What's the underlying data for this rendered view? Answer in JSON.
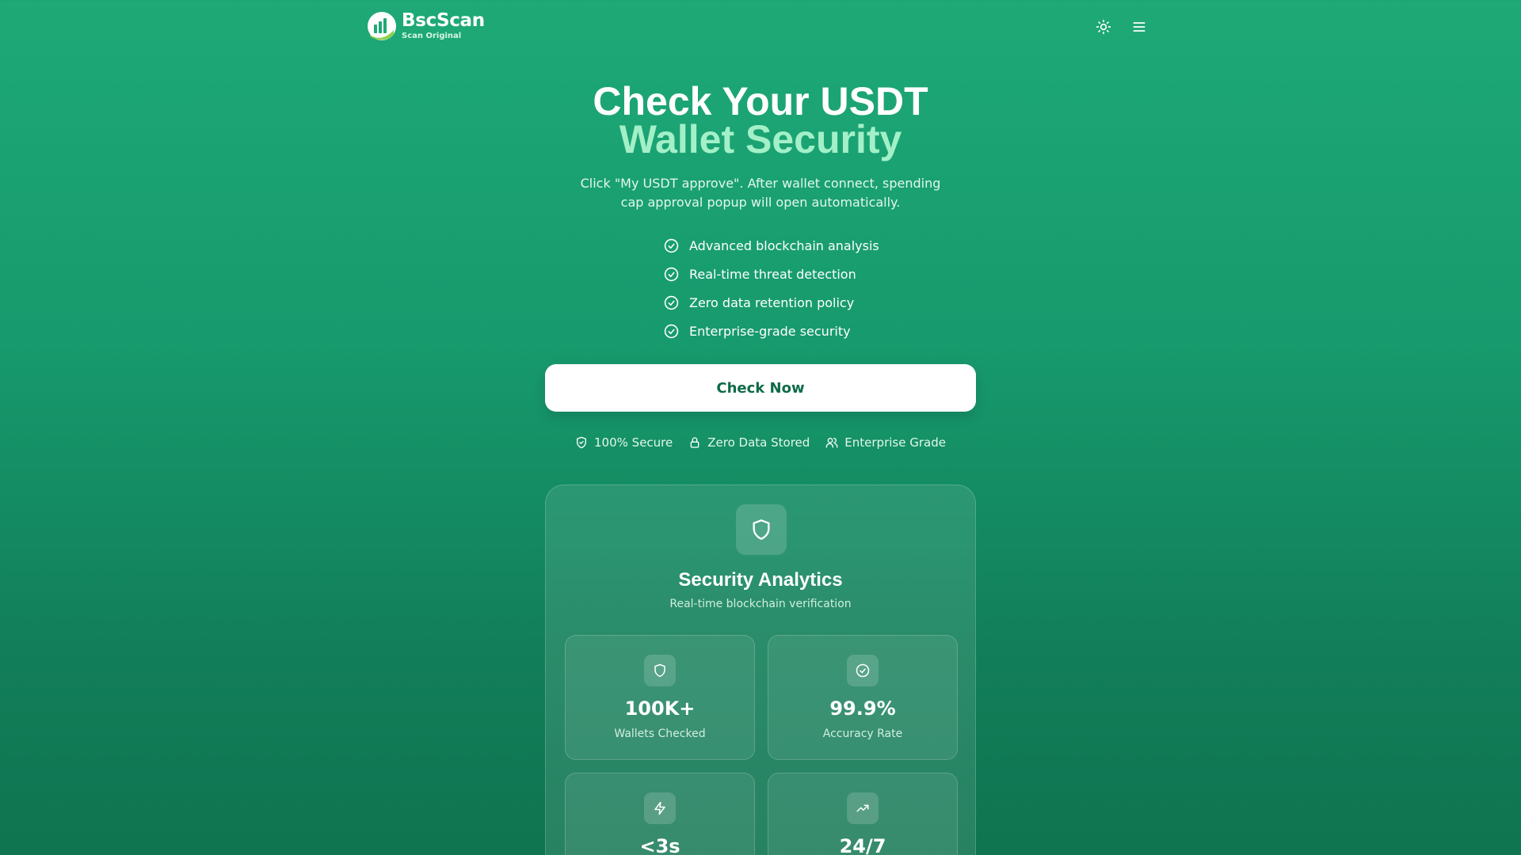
{
  "header": {
    "logo_name": "BscScan",
    "logo_sub": "Scan Original",
    "theme_icon": "sun-icon",
    "menu_icon": "hamburger-menu-icon"
  },
  "hero": {
    "title_line1": "Check Your USDT",
    "title_line2": "Wallet Security",
    "description": "Click \"My USDT approve\". After wallet connect, spending cap approval popup will open automatically.",
    "features": [
      "Advanced blockchain analysis",
      "Real-time threat detection",
      "Zero data retention policy",
      "Enterprise-grade security"
    ],
    "feature_icon": "check-circle-icon",
    "cta_label": "Check Now"
  },
  "badges": [
    {
      "label": "100% Secure",
      "icon": "shield-check-icon"
    },
    {
      "label": "Zero Data Stored",
      "icon": "lock-icon"
    },
    {
      "label": "Enterprise Grade",
      "icon": "users-icon"
    }
  ],
  "analytics": {
    "icon": "shield-icon",
    "title": "Security Analytics",
    "subtitle": "Real-time blockchain verification",
    "stats": [
      {
        "value": "100K+",
        "label": "Wallets Checked",
        "icon": "shield-icon"
      },
      {
        "value": "99.9%",
        "label": "Accuracy Rate",
        "icon": "check-circle-icon"
      },
      {
        "value": "<3s",
        "label": "",
        "icon": "lightning-icon"
      },
      {
        "value": "24/7",
        "label": "",
        "icon": "trending-up-icon"
      }
    ]
  },
  "colors": {
    "gradient_top": "#1ea977",
    "gradient_bottom": "#0f7450",
    "accent_text": "#a3f0c8",
    "button_text": "#0e6b48"
  }
}
